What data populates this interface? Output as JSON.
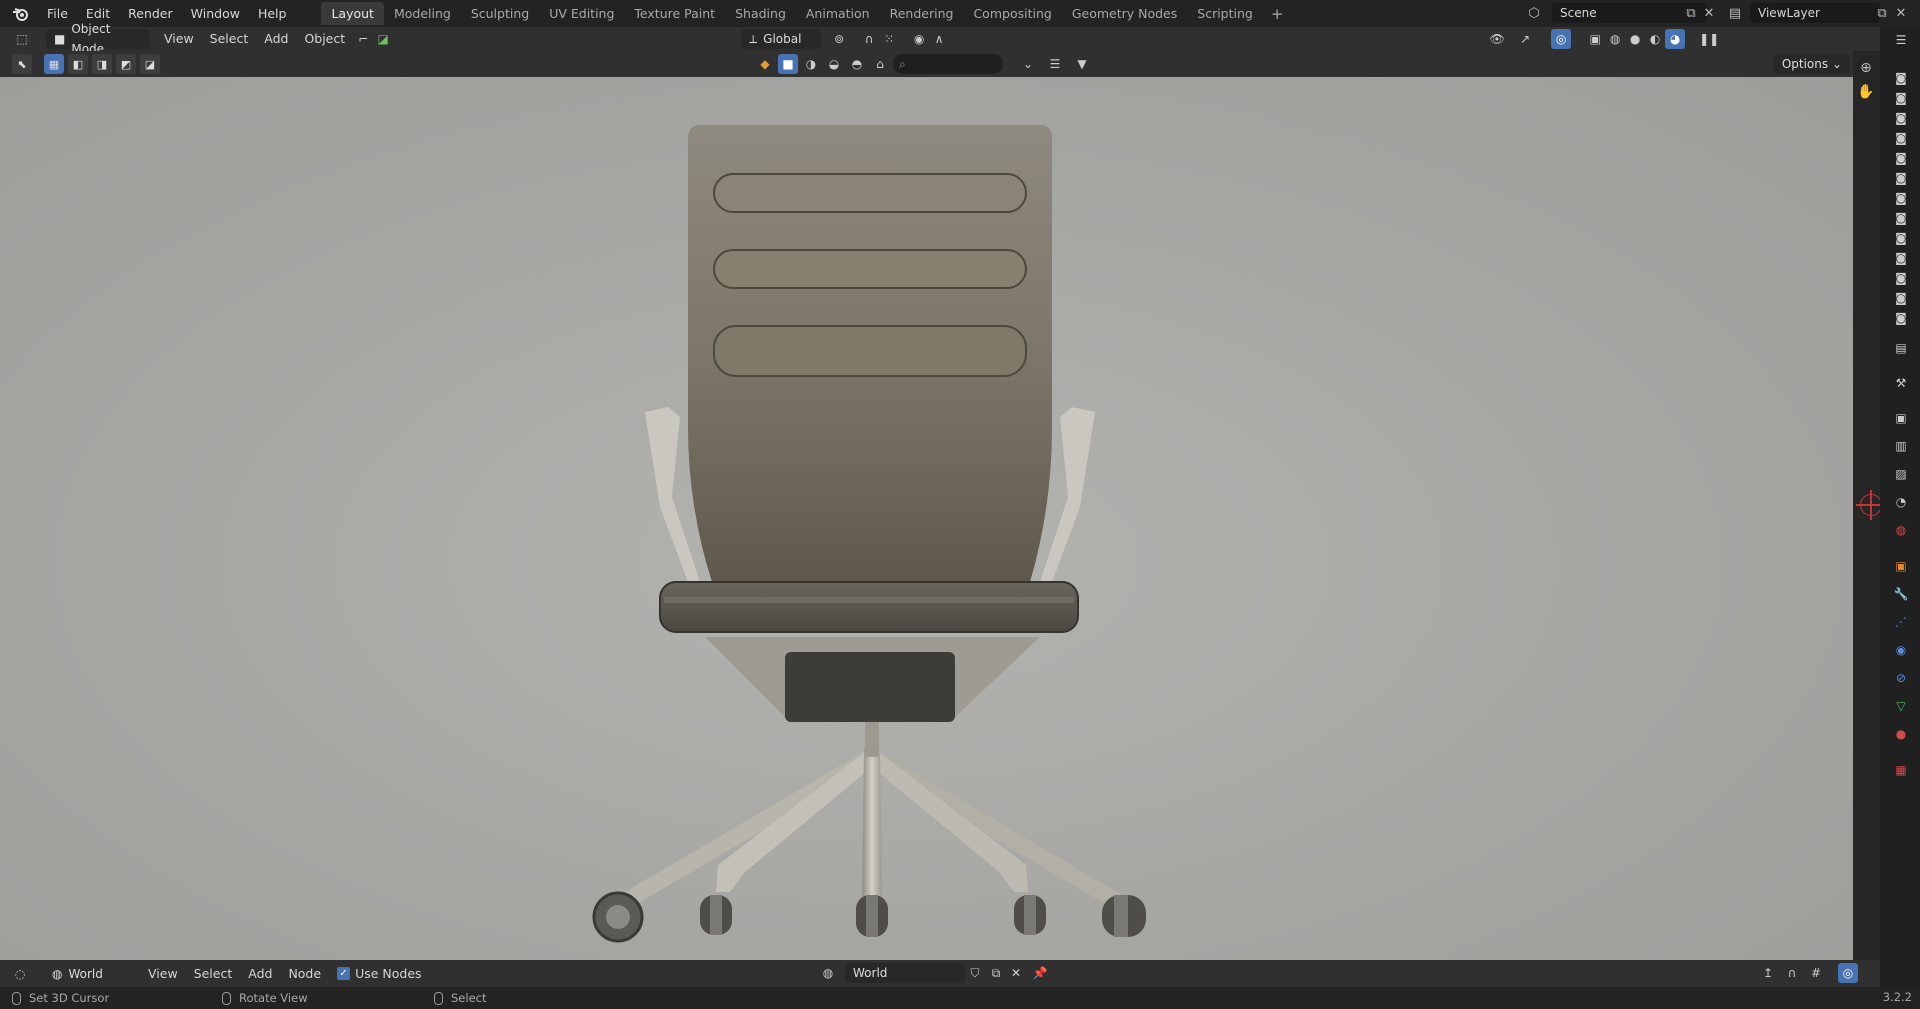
{
  "menu": [
    "File",
    "Edit",
    "Render",
    "Window",
    "Help"
  ],
  "workspaces": {
    "tabs": [
      "Layout",
      "Modeling",
      "Sculpting",
      "UV Editing",
      "Texture Paint",
      "Shading",
      "Animation",
      "Rendering",
      "Compositing",
      "Geometry Nodes",
      "Scripting"
    ],
    "active": "Layout",
    "add_label": "+"
  },
  "scene": {
    "name": "Scene",
    "view_layer": "ViewLayer"
  },
  "viewport_header": {
    "mode": "Object Mode",
    "menus": [
      "View",
      "Select",
      "Add",
      "Object"
    ],
    "transform_orientation": "Global"
  },
  "toolbar": {
    "options_label": "Options"
  },
  "node_editor": {
    "shader_type": "World",
    "menus": [
      "View",
      "Select",
      "Add",
      "Node"
    ],
    "use_nodes_label": "Use Nodes",
    "datablock": "World"
  },
  "statusbar": {
    "items": [
      "Set 3D Cursor",
      "Rotate View",
      "Select"
    ],
    "version": "3.2.2"
  },
  "colors": {
    "accent": "#4772b3",
    "viewport_bg": "#a8a8a5",
    "cursor": "#c93535"
  }
}
